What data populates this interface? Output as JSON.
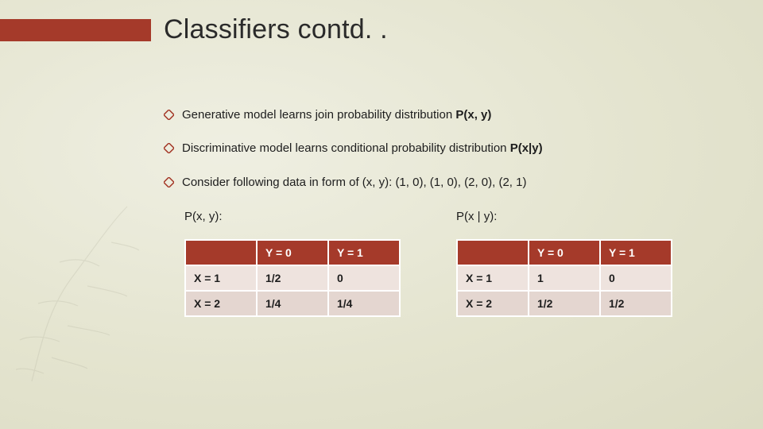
{
  "title": "Classifiers contd. .",
  "bullets": [
    {
      "pre": "Generative model learns join probability distribution ",
      "bold": "P(x, y)",
      "post": ""
    },
    {
      "pre": "Discriminative model learns conditional probability distribution ",
      "bold": "P(x|y)",
      "post": ""
    },
    {
      "pre": "Consider following data in form of (x, y):   (1, 0), (1, 0), (2, 0), (2, 1)",
      "bold": "",
      "post": ""
    }
  ],
  "colors": {
    "accent": "#a53a2a",
    "bg": "#e9e9d8"
  },
  "tables": [
    {
      "caption": "P(x, y):",
      "colHeaders": [
        "",
        "Y = 0",
        "Y = 1"
      ],
      "rows": [
        {
          "rh": "X = 1",
          "cells": [
            "1/2",
            "0"
          ]
        },
        {
          "rh": "X = 2",
          "cells": [
            "1/4",
            "1/4"
          ]
        }
      ]
    },
    {
      "caption": "P(x | y):",
      "colHeaders": [
        "",
        "Y = 0",
        "Y = 1"
      ],
      "rows": [
        {
          "rh": "X = 1",
          "cells": [
            "1",
            "0"
          ]
        },
        {
          "rh": "X = 2",
          "cells": [
            "1/2",
            "1/2"
          ]
        }
      ]
    }
  ],
  "chart_data": [
    {
      "type": "table",
      "title": "P(x, y)",
      "columns": [
        "",
        "Y = 0",
        "Y = 1"
      ],
      "rows": [
        [
          "X = 1",
          "1/2",
          "0"
        ],
        [
          "X = 2",
          "1/4",
          "1/4"
        ]
      ]
    },
    {
      "type": "table",
      "title": "P(x | y)",
      "columns": [
        "",
        "Y = 0",
        "Y = 1"
      ],
      "rows": [
        [
          "X = 1",
          "1",
          "0"
        ],
        [
          "X = 2",
          "1/2",
          "1/2"
        ]
      ]
    }
  ],
  "icon_names": {
    "bullet_diamond": "diamond-bullet-icon"
  }
}
